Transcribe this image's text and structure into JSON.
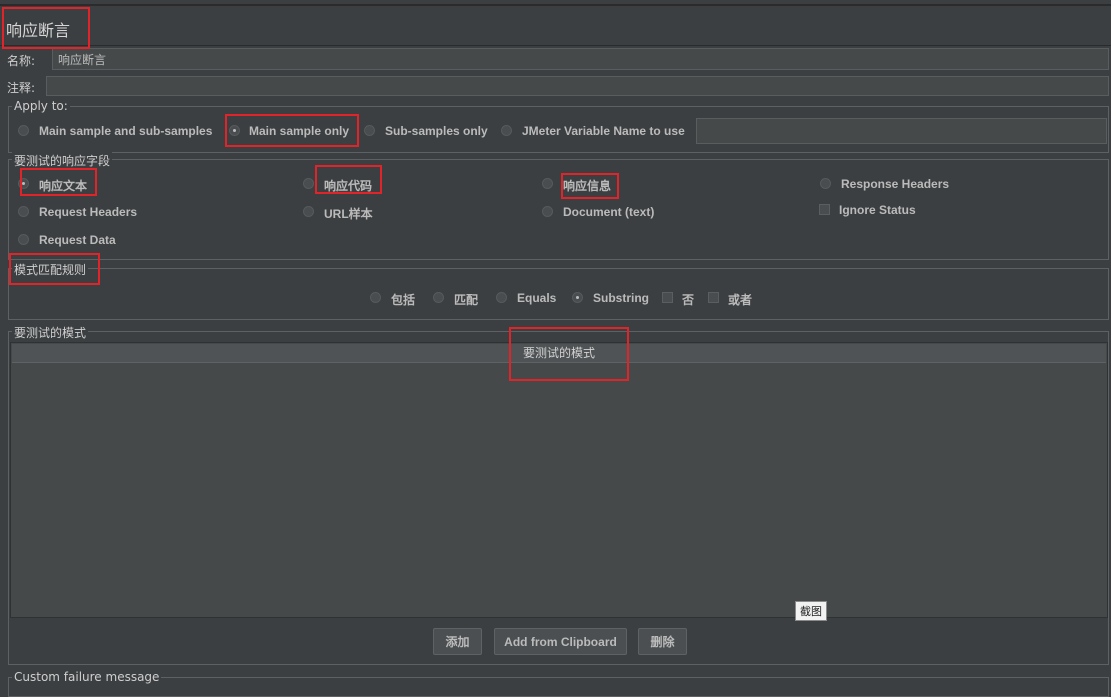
{
  "panel": {
    "title": "响应断言",
    "name_label": "名称:",
    "name_value": "响应断言",
    "comment_label": "注释:",
    "comment_value": ""
  },
  "apply_to": {
    "legend": "Apply to:",
    "options": [
      "Main sample and sub-samples",
      "Main sample only",
      "Sub-samples only",
      "JMeter Variable Name to use"
    ],
    "selected": "Main sample only",
    "variable_value": ""
  },
  "field_to_test": {
    "legend": "要测试的响应字段",
    "radios": [
      "响应文本",
      "响应代码",
      "响应信息",
      "Response Headers",
      "Request Headers",
      "URL样本",
      "Document (text)",
      "Request Data"
    ],
    "selected": "响应文本",
    "ignore_status_label": "Ignore Status"
  },
  "pattern_matching": {
    "legend": "模式匹配规则",
    "radios": [
      "包括",
      "匹配",
      "Equals",
      "Substring"
    ],
    "selected": "Substring",
    "checkboxes": [
      "否",
      "或者"
    ]
  },
  "patterns": {
    "legend": "要测试的模式",
    "column_header": "要测试的模式",
    "buttons": [
      "添加",
      "Add from Clipboard",
      "删除"
    ]
  },
  "custom_failure": {
    "legend": "Custom failure message"
  },
  "tooltip": "截图",
  "colors": {
    "background": "#3c3f41",
    "highlight": "#e0242a",
    "text": "#bbbbbb"
  }
}
